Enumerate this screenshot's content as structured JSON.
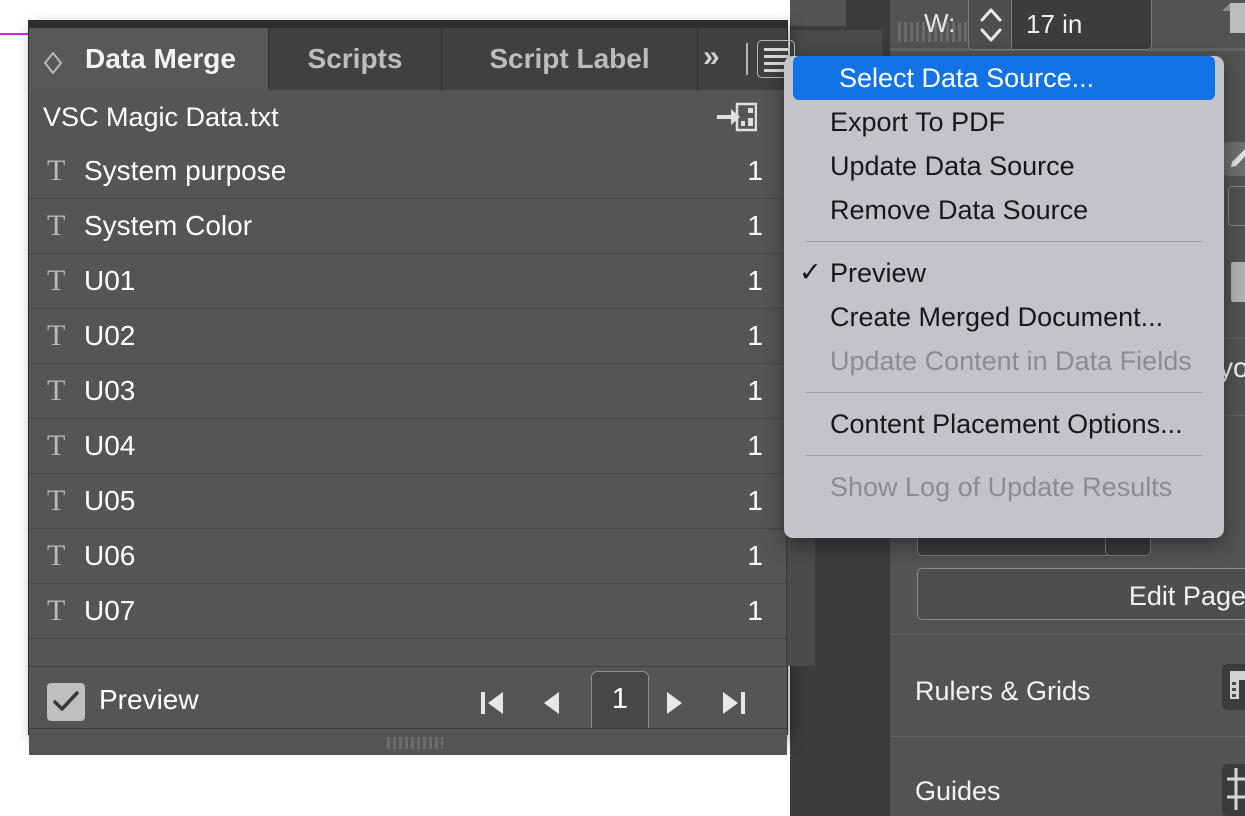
{
  "app": {
    "guide_color": "#e11fe1",
    "accent_color": "#1272e6",
    "panel_bg": "#555555",
    "menu_bg": "#c3c4ca"
  },
  "panel": {
    "tabs": [
      {
        "label": "Data Merge",
        "active": true
      },
      {
        "label": "Scripts",
        "active": false
      },
      {
        "label": "Script Label",
        "active": false
      }
    ],
    "overflow_label": "»",
    "menu_button_name": "panel-menu-button",
    "source_file": "VSC Magic Data.txt",
    "import_icon": "import-data-fields-icon",
    "fields": [
      {
        "type": "T",
        "name": "System purpose",
        "count": "1"
      },
      {
        "type": "T",
        "name": "System Color",
        "count": "1"
      },
      {
        "type": "T",
        "name": "U01",
        "count": "1"
      },
      {
        "type": "T",
        "name": "U02",
        "count": "1"
      },
      {
        "type": "T",
        "name": "U03",
        "count": "1"
      },
      {
        "type": "T",
        "name": "U04",
        "count": "1"
      },
      {
        "type": "T",
        "name": "U05",
        "count": "1"
      },
      {
        "type": "T",
        "name": "U06",
        "count": "1"
      },
      {
        "type": "T",
        "name": "U07",
        "count": "1"
      }
    ],
    "footer": {
      "preview_label": "Preview",
      "preview_checked": true,
      "page_value": "1",
      "nav": {
        "first": "first-record-button",
        "prev": "previous-record-button",
        "next": "next-record-button",
        "last": "last-record-button"
      }
    }
  },
  "menu": {
    "items": [
      {
        "label": "Select Data Source...",
        "state": "selected",
        "checked": false
      },
      {
        "label": "Export To PDF",
        "state": "enabled",
        "checked": false
      },
      {
        "label": "Update Data Source",
        "state": "enabled",
        "checked": false
      },
      {
        "label": "Remove Data Source",
        "state": "enabled",
        "checked": false
      },
      {
        "separator": true
      },
      {
        "label": "Preview",
        "state": "enabled",
        "checked": true
      },
      {
        "label": "Create Merged Document...",
        "state": "enabled",
        "checked": false
      },
      {
        "label": "Update Content in Data Fields",
        "state": "disabled",
        "checked": false
      },
      {
        "separator": true
      },
      {
        "label": "Content Placement Options...",
        "state": "enabled",
        "checked": false
      },
      {
        "separator": true
      },
      {
        "label": "Show Log of Update Results",
        "state": "disabled",
        "checked": false
      }
    ]
  },
  "properties_panel": {
    "width_label": "W:",
    "width_value": "17 in",
    "edit_page_label": "Edit Page",
    "sections": [
      {
        "label": "Rulers & Grids",
        "icon": "ruler-grid-icon"
      },
      {
        "label": "Guides",
        "icon": "guides-grid-icon"
      }
    ],
    "partial_text": "yo",
    "icons": {
      "page": "page-icon",
      "pencil": "pencil-edit-icon"
    }
  }
}
